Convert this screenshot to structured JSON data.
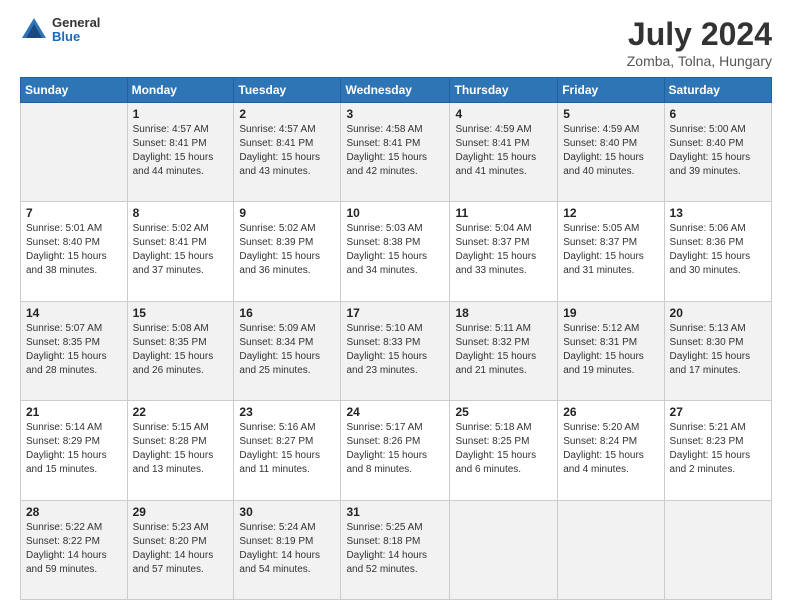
{
  "header": {
    "logo_general": "General",
    "logo_blue": "Blue",
    "month_year": "July 2024",
    "location": "Zomba, Tolna, Hungary"
  },
  "days_of_week": [
    "Sunday",
    "Monday",
    "Tuesday",
    "Wednesday",
    "Thursday",
    "Friday",
    "Saturday"
  ],
  "weeks": [
    [
      {
        "date": "",
        "info": ""
      },
      {
        "date": "1",
        "info": "Sunrise: 4:57 AM\nSunset: 8:41 PM\nDaylight: 15 hours\nand 44 minutes."
      },
      {
        "date": "2",
        "info": "Sunrise: 4:57 AM\nSunset: 8:41 PM\nDaylight: 15 hours\nand 43 minutes."
      },
      {
        "date": "3",
        "info": "Sunrise: 4:58 AM\nSunset: 8:41 PM\nDaylight: 15 hours\nand 42 minutes."
      },
      {
        "date": "4",
        "info": "Sunrise: 4:59 AM\nSunset: 8:41 PM\nDaylight: 15 hours\nand 41 minutes."
      },
      {
        "date": "5",
        "info": "Sunrise: 4:59 AM\nSunset: 8:40 PM\nDaylight: 15 hours\nand 40 minutes."
      },
      {
        "date": "6",
        "info": "Sunrise: 5:00 AM\nSunset: 8:40 PM\nDaylight: 15 hours\nand 39 minutes."
      }
    ],
    [
      {
        "date": "7",
        "info": "Sunrise: 5:01 AM\nSunset: 8:40 PM\nDaylight: 15 hours\nand 38 minutes."
      },
      {
        "date": "8",
        "info": "Sunrise: 5:02 AM\nSunset: 8:41 PM\nDaylight: 15 hours\nand 37 minutes."
      },
      {
        "date": "9",
        "info": "Sunrise: 5:02 AM\nSunset: 8:39 PM\nDaylight: 15 hours\nand 36 minutes."
      },
      {
        "date": "10",
        "info": "Sunrise: 5:03 AM\nSunset: 8:38 PM\nDaylight: 15 hours\nand 34 minutes."
      },
      {
        "date": "11",
        "info": "Sunrise: 5:04 AM\nSunset: 8:37 PM\nDaylight: 15 hours\nand 33 minutes."
      },
      {
        "date": "12",
        "info": "Sunrise: 5:05 AM\nSunset: 8:37 PM\nDaylight: 15 hours\nand 31 minutes."
      },
      {
        "date": "13",
        "info": "Sunrise: 5:06 AM\nSunset: 8:36 PM\nDaylight: 15 hours\nand 30 minutes."
      }
    ],
    [
      {
        "date": "14",
        "info": "Sunrise: 5:07 AM\nSunset: 8:35 PM\nDaylight: 15 hours\nand 28 minutes."
      },
      {
        "date": "15",
        "info": "Sunrise: 5:08 AM\nSunset: 8:35 PM\nDaylight: 15 hours\nand 26 minutes."
      },
      {
        "date": "16",
        "info": "Sunrise: 5:09 AM\nSunset: 8:34 PM\nDaylight: 15 hours\nand 25 minutes."
      },
      {
        "date": "17",
        "info": "Sunrise: 5:10 AM\nSunset: 8:33 PM\nDaylight: 15 hours\nand 23 minutes."
      },
      {
        "date": "18",
        "info": "Sunrise: 5:11 AM\nSunset: 8:32 PM\nDaylight: 15 hours\nand 21 minutes."
      },
      {
        "date": "19",
        "info": "Sunrise: 5:12 AM\nSunset: 8:31 PM\nDaylight: 15 hours\nand 19 minutes."
      },
      {
        "date": "20",
        "info": "Sunrise: 5:13 AM\nSunset: 8:30 PM\nDaylight: 15 hours\nand 17 minutes."
      }
    ],
    [
      {
        "date": "21",
        "info": "Sunrise: 5:14 AM\nSunset: 8:29 PM\nDaylight: 15 hours\nand 15 minutes."
      },
      {
        "date": "22",
        "info": "Sunrise: 5:15 AM\nSunset: 8:28 PM\nDaylight: 15 hours\nand 13 minutes."
      },
      {
        "date": "23",
        "info": "Sunrise: 5:16 AM\nSunset: 8:27 PM\nDaylight: 15 hours\nand 11 minutes."
      },
      {
        "date": "24",
        "info": "Sunrise: 5:17 AM\nSunset: 8:26 PM\nDaylight: 15 hours\nand 8 minutes."
      },
      {
        "date": "25",
        "info": "Sunrise: 5:18 AM\nSunset: 8:25 PM\nDaylight: 15 hours\nand 6 minutes."
      },
      {
        "date": "26",
        "info": "Sunrise: 5:20 AM\nSunset: 8:24 PM\nDaylight: 15 hours\nand 4 minutes."
      },
      {
        "date": "27",
        "info": "Sunrise: 5:21 AM\nSunset: 8:23 PM\nDaylight: 15 hours\nand 2 minutes."
      }
    ],
    [
      {
        "date": "28",
        "info": "Sunrise: 5:22 AM\nSunset: 8:22 PM\nDaylight: 14 hours\nand 59 minutes."
      },
      {
        "date": "29",
        "info": "Sunrise: 5:23 AM\nSunset: 8:20 PM\nDaylight: 14 hours\nand 57 minutes."
      },
      {
        "date": "30",
        "info": "Sunrise: 5:24 AM\nSunset: 8:19 PM\nDaylight: 14 hours\nand 54 minutes."
      },
      {
        "date": "31",
        "info": "Sunrise: 5:25 AM\nSunset: 8:18 PM\nDaylight: 14 hours\nand 52 minutes."
      },
      {
        "date": "",
        "info": ""
      },
      {
        "date": "",
        "info": ""
      },
      {
        "date": "",
        "info": ""
      }
    ]
  ]
}
